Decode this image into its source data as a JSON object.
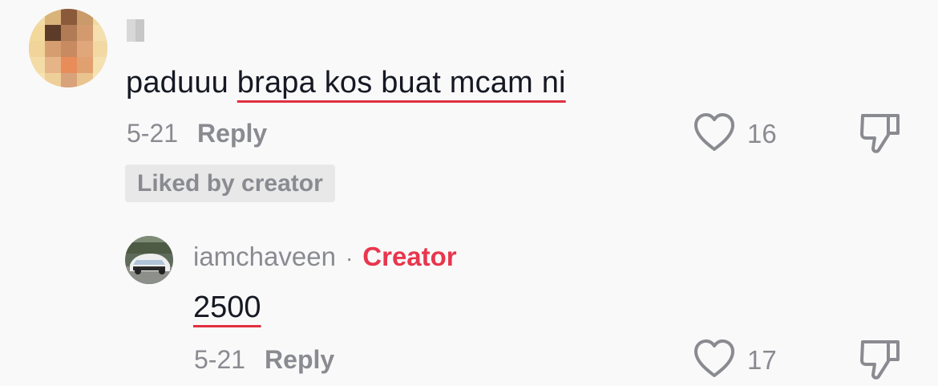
{
  "comment": {
    "username": "",
    "text_plain": "paduuu ",
    "text_highlighted": "brapa kos buat mcam ni",
    "date": "5-21",
    "reply_label": "Reply",
    "like_count": "16",
    "liked_badge": "Liked by creator"
  },
  "reply": {
    "username": "iamchaveen",
    "separator": "·",
    "creator_label": "Creator",
    "text": "2500",
    "date": "5-21",
    "reply_label": "Reply",
    "like_count": "17"
  },
  "colors": {
    "background": "#f9f9f9",
    "muted_text": "#8a8b91",
    "creator_accent": "#e8364d",
    "underline": "#e0303f",
    "badge_bg": "#e8e8e9"
  },
  "icons": {
    "like": "heart-outline-icon",
    "dislike": "thumbs-down-icon"
  }
}
